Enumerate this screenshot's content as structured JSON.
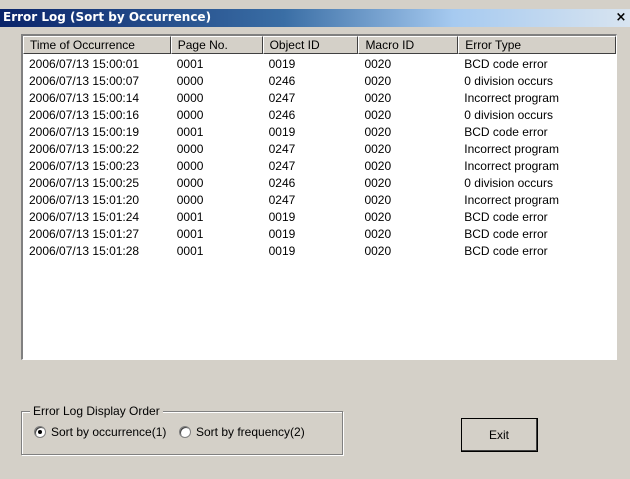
{
  "window": {
    "title": "Error Log (Sort by Occurrence)",
    "close_label": "×"
  },
  "table": {
    "columns": [
      "Time of Occurrence",
      "Page No.",
      "Object ID",
      "Macro ID",
      "Error Type"
    ],
    "rows": [
      [
        "2006/07/13 15:00:01",
        "0001",
        "0019",
        "0020",
        "BCD code error"
      ],
      [
        "2006/07/13 15:00:07",
        "0000",
        "0246",
        "0020",
        "0 division occurs"
      ],
      [
        "2006/07/13 15:00:14",
        "0000",
        "0247",
        "0020",
        "Incorrect program"
      ],
      [
        "2006/07/13 15:00:16",
        "0000",
        "0246",
        "0020",
        "0 division occurs"
      ],
      [
        "2006/07/13 15:00:19",
        "0001",
        "0019",
        "0020",
        "BCD code error"
      ],
      [
        "2006/07/13 15:00:22",
        "0000",
        "0247",
        "0020",
        "Incorrect program"
      ],
      [
        "2006/07/13 15:00:23",
        "0000",
        "0247",
        "0020",
        "Incorrect program"
      ],
      [
        "2006/07/13 15:00:25",
        "0000",
        "0246",
        "0020",
        "0 division occurs"
      ],
      [
        "2006/07/13 15:01:20",
        "0000",
        "0247",
        "0020",
        "Incorrect program"
      ],
      [
        "2006/07/13 15:01:24",
        "0001",
        "0019",
        "0020",
        "BCD code error"
      ],
      [
        "2006/07/13 15:01:27",
        "0001",
        "0019",
        "0020",
        "BCD code error"
      ],
      [
        "2006/07/13 15:01:28",
        "0001",
        "0019",
        "0020",
        "BCD code error"
      ]
    ]
  },
  "display_order": {
    "legend": "Error Log Display Order",
    "options": [
      {
        "label": "Sort by occurrence(1)",
        "selected": true
      },
      {
        "label": "Sort by frequency(2)",
        "selected": false
      }
    ]
  },
  "buttons": {
    "exit_label": "Exit"
  }
}
